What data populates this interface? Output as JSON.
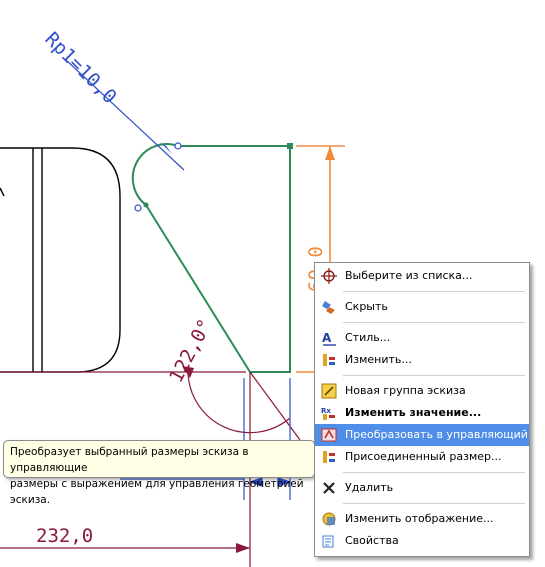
{
  "dimensions": {
    "radius": "Rp1=10,0",
    "height": "60,0",
    "angle": "122,0°",
    "length": "232,0"
  },
  "context_menu": {
    "items": [
      {
        "label": "Выберите из списка...",
        "icon": "crosshair-icon",
        "bold": false,
        "selected": false
      },
      {
        "label": "Скрыть",
        "icon": "hide-icon",
        "bold": false,
        "selected": false
      },
      {
        "label": "Стиль...",
        "icon": "style-icon",
        "bold": false,
        "selected": false
      },
      {
        "label": "Изменить...",
        "icon": "edit-icon",
        "bold": false,
        "selected": false
      },
      {
        "label": "Новая группа эскиза",
        "icon": "sketch-group-icon",
        "bold": false,
        "selected": false
      },
      {
        "label": "Изменить значение...",
        "icon": "edit-value-icon",
        "bold": true,
        "selected": false
      },
      {
        "label": "Преобразовать в управляющий",
        "icon": "convert-driving-icon",
        "bold": false,
        "selected": true
      },
      {
        "label": "Присоединенный размер...",
        "icon": "attached-dimension-icon",
        "bold": false,
        "selected": false
      },
      {
        "label": "Удалить",
        "icon": "delete-icon",
        "bold": false,
        "selected": false
      },
      {
        "label": "Изменить отображение...",
        "icon": "display-icon",
        "bold": false,
        "selected": false
      },
      {
        "label": "Свойства",
        "icon": "properties-icon",
        "bold": false,
        "selected": false
      }
    ]
  },
  "tooltip": {
    "line1": "Преобразует выбранный размеры эскиза в управляющие",
    "line2": "размеры с выражением для управления геометрией эскиза."
  },
  "colors": {
    "profile": "#2e8b57",
    "dimension_blue": "#3050c8",
    "dimension_orange": "#f08a3c",
    "dimension_maroon": "#8b1a3a",
    "selection": "#4f8ee8"
  }
}
